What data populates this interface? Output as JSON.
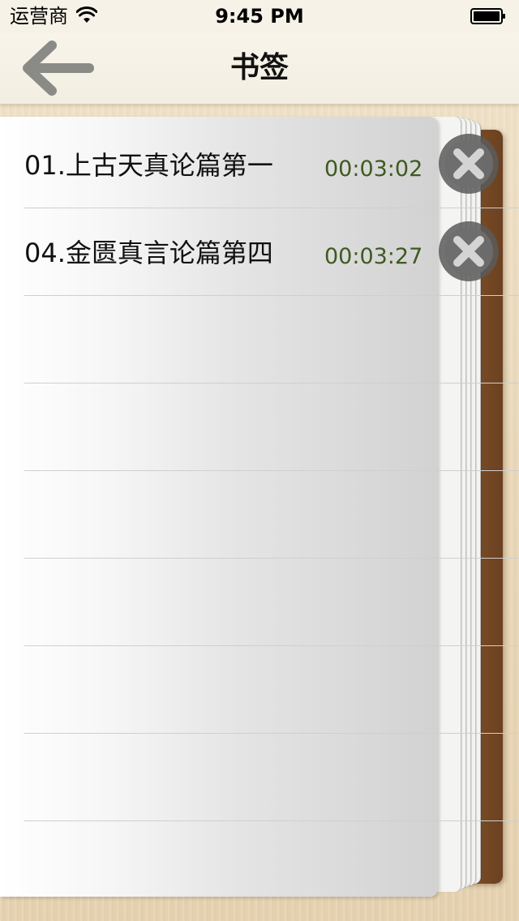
{
  "status_bar": {
    "carrier": "运营商",
    "time": "9:45 PM",
    "wifi_icon": "wifi-icon",
    "battery_icon": "battery-icon"
  },
  "nav_bar": {
    "title": "书签",
    "back_icon": "arrow-left-icon"
  },
  "bookmarks": [
    {
      "title": "01.上古天真论篇第一",
      "time": "00:03:02",
      "delete_icon": "close-circle-icon"
    },
    {
      "title": "04.金匮真言论篇第四",
      "time": "00:03:27",
      "delete_icon": "close-circle-icon"
    }
  ],
  "colors": {
    "time_text": "#3d5a1f",
    "spine": "#7a4d27",
    "nav_bg": "#f6f2e8"
  }
}
